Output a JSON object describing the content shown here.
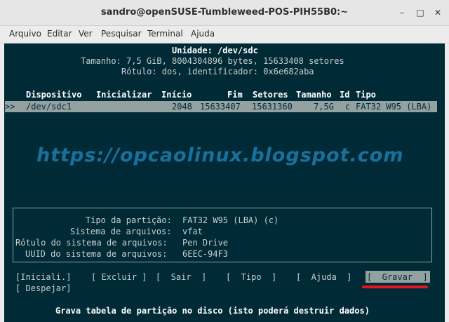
{
  "window": {
    "title": "sandro@openSUSE-Tumbleweed-POS-PIH55B0:~"
  },
  "menu": [
    "Arquivo",
    "Editar",
    "Ver",
    "Pesquisar",
    "Terminal",
    "Ajuda"
  ],
  "header": {
    "unit": "Unidade: /dev/sdc",
    "size": "Tamanho: 7,5 GiB, 8004304896 bytes, 15633408 setores",
    "label": "Rótulo: dos, identificador: 0x6e682aba"
  },
  "table": {
    "columns": [
      "Dispositivo",
      "Inicializar",
      "Início",
      "Fim",
      "Setores",
      "Tamanho",
      "Id",
      "Tipo"
    ],
    "rows": [
      {
        "cursor": ">>",
        "device": "/dev/sdc1",
        "boot": "",
        "start": "2048",
        "end": "15633407",
        "sectors": "15631360",
        "size": "7,5G",
        "id": "c",
        "type": "FAT32 W95 (LBA)"
      }
    ]
  },
  "watermark": "https://opcaolinux.blogspot.com",
  "details": {
    "partition_type_label": "Tipo da partição:",
    "partition_type": "FAT32 W95 (LBA) (c)",
    "filesystem_label": "Sistema de arquivos:",
    "filesystem": "vfat",
    "fs_label_label": "Rótulo do sistema de arquivos:",
    "fs_label": "Pen Drive",
    "uuid_label": "UUID do sistema de arquivos:",
    "uuid": "6EEC-94F3"
  },
  "actions": [
    "[Iniciali.]",
    "[ Excluir ]",
    "[  Sair  ]",
    "[  Tipo  ]",
    "[  Ajuda  ]",
    "[  Gravar  ]",
    "[ Despejar]"
  ],
  "status": "Grava tabela de partição no disco (isto poderá destruir dados)",
  "colors": {
    "terminal_bg": "#002b36",
    "selection": "#93a1a1",
    "underline": "#e8141c",
    "watermark": "#1f7db0"
  }
}
